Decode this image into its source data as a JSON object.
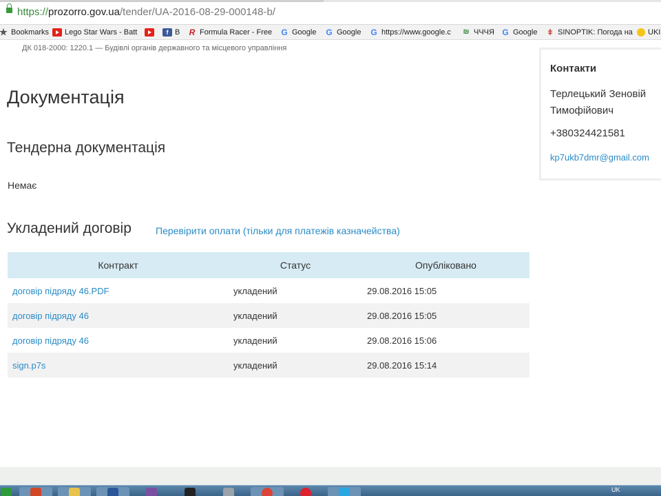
{
  "browser": {
    "url": {
      "scheme": "https://",
      "host": "prozorro.gov.ua",
      "path": "/tender/UA-2016-08-29-000148-b/"
    },
    "bookmarks": [
      {
        "label": "Bookmarks",
        "icon": "star-icon"
      },
      {
        "label": "Lego Star Wars - Batt",
        "icon": "youtube-icon"
      },
      {
        "label": "",
        "icon": "youtube-icon"
      },
      {
        "label": "B",
        "icon": "facebook-icon"
      },
      {
        "label": "Formula Racer - Free",
        "icon": "formula-racer-icon"
      },
      {
        "label": "Google",
        "icon": "google-icon"
      },
      {
        "label": "Google",
        "icon": "google-icon"
      },
      {
        "label": "https://www.google.c",
        "icon": "google-icon"
      },
      {
        "label": "ЧЧЧЯ",
        "icon": "gr-icon"
      },
      {
        "label": "Google",
        "icon": "google-icon"
      },
      {
        "label": "SINOPTIK: Погода на",
        "icon": "thermometer-icon"
      },
      {
        "label": "UKI",
        "icon": "uki-icon"
      }
    ]
  },
  "page": {
    "classifier": "ДК 018-2000: 1220.1 — Будівлі органів державного та місцевого управління",
    "documentation_title": "Документація",
    "tender_docs_title": "Тендерна документація",
    "tender_docs_empty": "Немає",
    "contract_title": "Укладений договір",
    "check_payments_link": "Перевірити оплати (тільки для платежів казначейства)",
    "table": {
      "headers": [
        "Контракт",
        "Статус",
        "Опубліковано"
      ],
      "rows": [
        {
          "contract": "договір підряду 46.PDF",
          "status": "укладений",
          "published": "29.08.2016 15:05"
        },
        {
          "contract": "договір підряду 46",
          "status": "укладений",
          "published": "29.08.2016 15:05"
        },
        {
          "contract": "договір підряду 46",
          "status": "укладений",
          "published": "29.08.2016 15:06"
        },
        {
          "contract": "sign.p7s",
          "status": "укладений",
          "published": "29.08.2016 15:14"
        }
      ]
    },
    "contacts": {
      "title": "Контакти",
      "person": "Терлецький Зеновій Тимофійович",
      "phone": "+380324421581",
      "email": "kp7ukb7dmr@gmail.com"
    }
  },
  "taskbar": {
    "tray_text": "UK",
    "colors": {
      "accent_link": "#2a8bc6",
      "table_header_bg": "#d7ebf4"
    }
  }
}
